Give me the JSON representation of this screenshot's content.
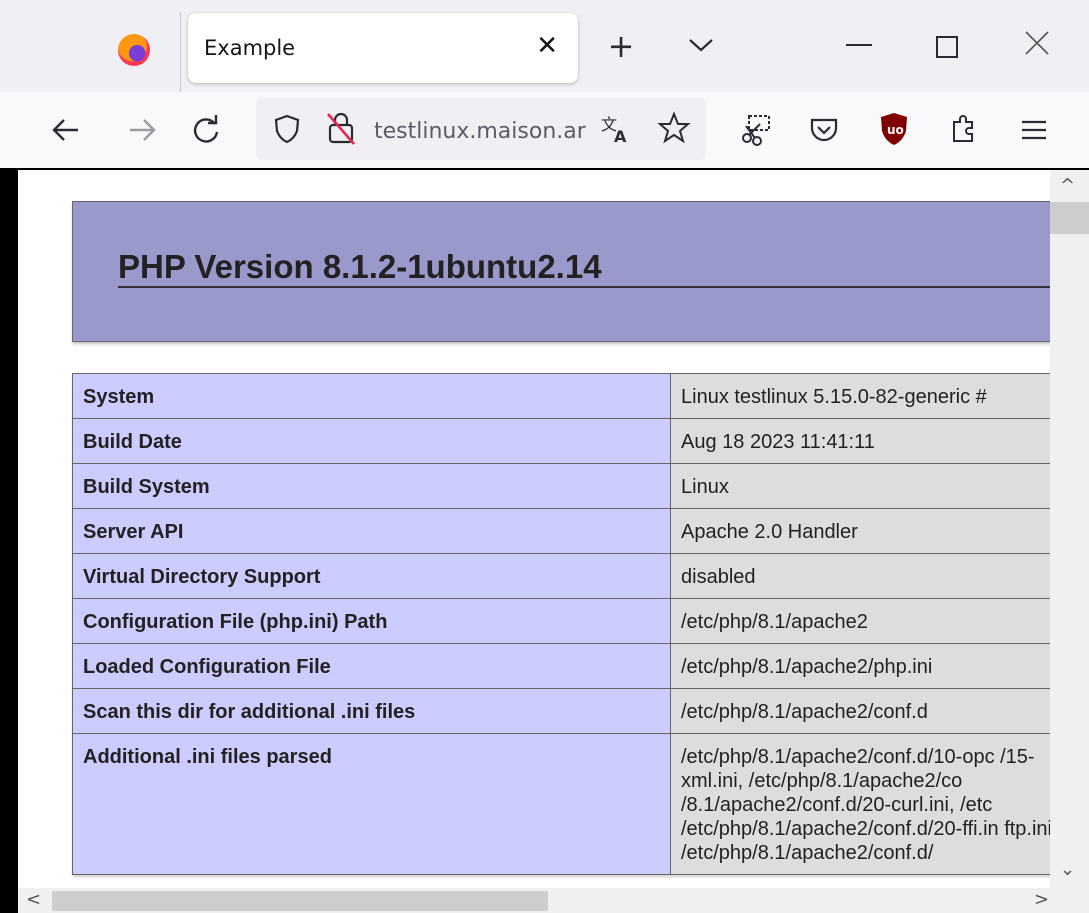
{
  "browser": {
    "tab_title": "Example",
    "url": "testlinux.maison.ar",
    "tab_close_glyph": "✕",
    "new_tab_glyph": "+",
    "icons": [
      "firefox-icon",
      "back-icon",
      "forward-icon",
      "reload-icon",
      "shield-icon",
      "insecure-lock-icon",
      "translate-icon",
      "bookmark-star-icon",
      "screenshot-icon",
      "pocket-icon",
      "ublock-icon",
      "extensions-icon",
      "menu-icon"
    ]
  },
  "page": {
    "title": "PHP Version 8.1.2-1ubuntu2.14",
    "colors": {
      "header_bg": "#9999cc",
      "label_bg": "#ccccff",
      "value_bg": "#dddddd"
    },
    "rows": [
      {
        "label": "System",
        "value": "Linux testlinux 5.15.0-82-generic #"
      },
      {
        "label": "Build Date",
        "value": "Aug 18 2023 11:41:11"
      },
      {
        "label": "Build System",
        "value": "Linux"
      },
      {
        "label": "Server API",
        "value": "Apache 2.0 Handler"
      },
      {
        "label": "Virtual Directory Support",
        "value": "disabled"
      },
      {
        "label": "Configuration File (php.ini) Path",
        "value": "/etc/php/8.1/apache2"
      },
      {
        "label": "Loaded Configuration File",
        "value": "/etc/php/8.1/apache2/php.ini"
      },
      {
        "label": "Scan this dir for additional .ini files",
        "value": "/etc/php/8.1/apache2/conf.d"
      },
      {
        "label": "Additional .ini files parsed",
        "value": "/etc/php/8.1/apache2/conf.d/10-opc /15-xml.ini, /etc/php/8.1/apache2/co /8.1/apache2/conf.d/20-curl.ini, /etc /etc/php/8.1/apache2/conf.d/20-ffi.in ftp.ini, /etc/php/8.1/apache2/conf.d/"
      }
    ]
  }
}
